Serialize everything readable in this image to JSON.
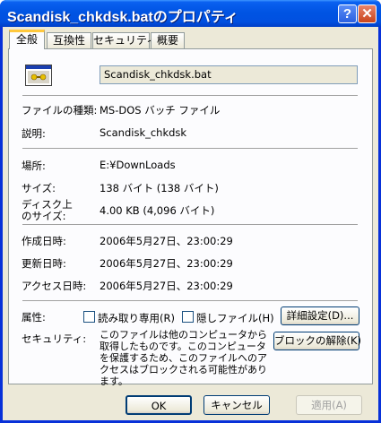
{
  "window": {
    "title": "Scandisk_chkdsk.batのプロパティ",
    "help_glyph": "?",
    "close_glyph": "✕"
  },
  "tabs": [
    {
      "label": "全般",
      "active": true
    },
    {
      "label": "互換性"
    },
    {
      "label": "セキュリティ"
    },
    {
      "label": "概要"
    }
  ],
  "general": {
    "file_icon": "msdos-batch-icon",
    "file_name": "Scandisk_chkdsk.bat",
    "fields": {
      "type_label": "ファイルの種類:",
      "type_value": "MS-DOS バッチ ファイル",
      "desc_label": "説明:",
      "desc_value": "Scandisk_chkdsk",
      "location_label": "場所:",
      "location_value": "E:¥DownLoads",
      "size_label": "サイズ:",
      "size_value": "138 バイト (138 バイト)",
      "disk_size_label_1": "ディスク上",
      "disk_size_label_2": "のサイズ:",
      "disk_size_value": "4.00 KB (4,096 バイト)",
      "created_label": "作成日時:",
      "created_value": "2006年5月27日、23:00:29",
      "modified_label": "更新日時:",
      "modified_value": "2006年5月27日、23:00:29",
      "accessed_label": "アクセス日時:",
      "accessed_value": "2006年5月27日、23:00:29"
    },
    "attributes": {
      "label": "属性:",
      "readonly": {
        "label": "読み取り専用(R)",
        "checked": false
      },
      "hidden": {
        "label": "隠しファイル(H)",
        "checked": false
      },
      "advanced_button": "詳細設定(D)..."
    },
    "security": {
      "label": "セキュリティ:",
      "text": "このファイルは他のコンピュータから取得したものです。このコンピュータを保護するため、このファイルへのアクセスはブロックされる可能性があります。",
      "unblock_button": "ブロックの解除(K)"
    }
  },
  "buttons": {
    "ok": "OK",
    "cancel": "キャンセル",
    "apply": "適用(A)"
  },
  "colors": {
    "title_bar": "#0054e3",
    "dialog_bg": "#ece9d8",
    "tab_highlight": "#ffc83c"
  }
}
